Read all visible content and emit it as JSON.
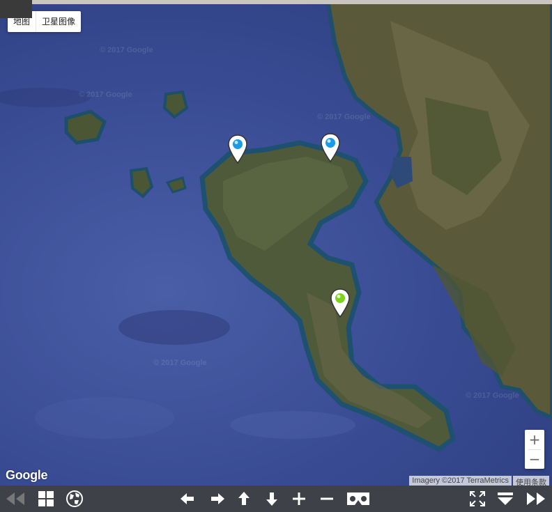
{
  "map_type": {
    "map_label": "地图",
    "satellite_label": "卫星图像"
  },
  "watermarks": [
    "© 2017 Google",
    "© 2017 Google",
    "© 2017 Google",
    "© 2017 Google",
    "© 2017 Google"
  ],
  "google_logo": "Google",
  "attribution": {
    "imagery": "Imagery ©2017 TerraMetrics",
    "terms": "使用条款"
  },
  "zoom": {
    "in": "+",
    "out": "−"
  },
  "markers": [
    {
      "color": "#1a9be8",
      "type": "blue"
    },
    {
      "color": "#1a9be8",
      "type": "blue"
    },
    {
      "color": "#7ed321",
      "type": "green"
    }
  ],
  "toolbar_icons": [
    "rewind-icon",
    "grid-icon",
    "globe-icon",
    "arrow-left-icon",
    "arrow-right-icon",
    "arrow-up-icon",
    "arrow-down-icon",
    "zoom-in-icon",
    "zoom-out-icon",
    "vr-icon",
    "fullscreen-icon",
    "hide-icon",
    "fast-forward-icon"
  ]
}
